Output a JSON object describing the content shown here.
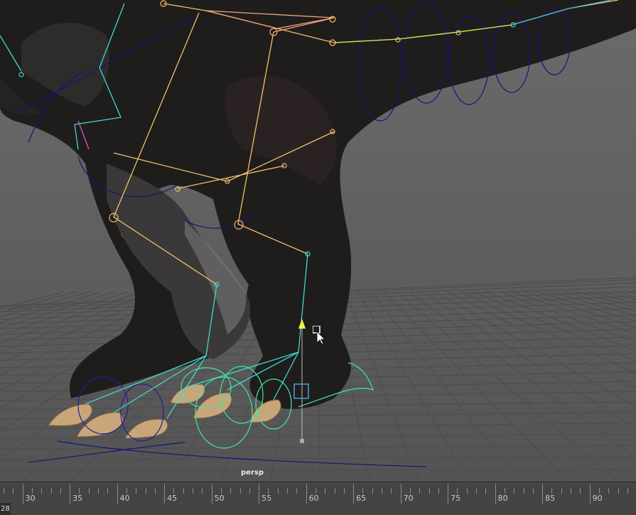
{
  "viewport": {
    "camera": "persp",
    "grid": true,
    "icons": [
      "trex-model",
      "ik-handle-icon",
      "mouse-cursor-icon"
    ]
  },
  "timeline": {
    "current_frame": "28",
    "ticks": [
      "30",
      "35",
      "40",
      "45",
      "50",
      "55",
      "60",
      "65",
      "70",
      "75",
      "80",
      "85",
      "90"
    ]
  },
  "colors": {
    "viewport_bg": "#5d5d5d",
    "grid_line": "#4a4a4a",
    "spine_joint": "#f6c66b",
    "leg_joint_orange": "#f5b46a",
    "foot_joint_cyan": "#3fd9cf",
    "control_curve_green": "#3ee8a4",
    "control_curve_blue": "#1a1a8a",
    "timeline_bg": "#444444"
  }
}
